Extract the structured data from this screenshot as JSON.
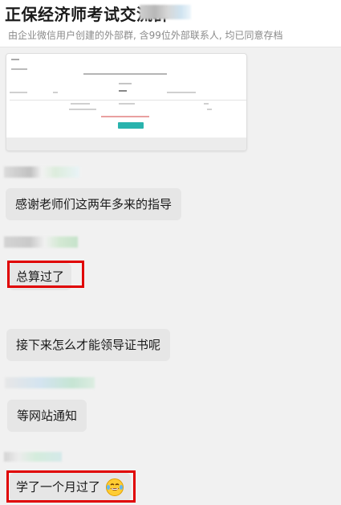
{
  "header": {
    "title": "正保经济师考试交流群",
    "subtitle": "由企业微信用户创建的外部群, 含99位外部联系人, 均已同意存档"
  },
  "messages": [
    {
      "text": "感谢老师们这两年多来的指导"
    },
    {
      "text": "总算过了"
    },
    {
      "text": "接下来怎么才能领导证书呢"
    },
    {
      "text": "等网站通知"
    },
    {
      "text": "学了一个月过了"
    }
  ],
  "icons": {
    "emoji": "laughing-tears-emoji"
  },
  "colors": {
    "highlight": "#e00000",
    "bubble": "#e6e6e6",
    "background": "#f1f1f1"
  }
}
